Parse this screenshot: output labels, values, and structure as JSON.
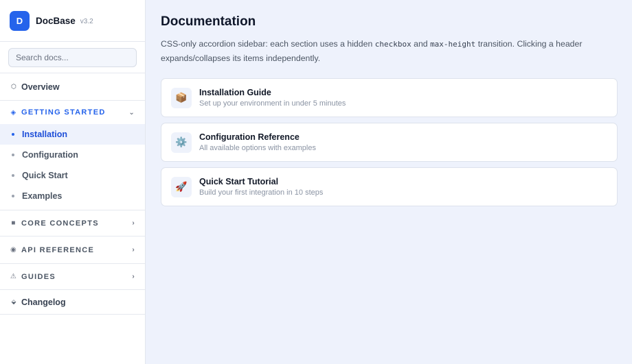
{
  "brand": {
    "logo_letter": "D",
    "name": "DocBase",
    "version": "v3.2"
  },
  "search": {
    "placeholder": "Search docs..."
  },
  "sidebar": {
    "overview": {
      "icon": "hexagon-outline-icon",
      "glyph": "⬡",
      "label": "Overview"
    },
    "sections": [
      {
        "icon": "diamond-icon",
        "glyph": "◈",
        "label": "GETTING STARTED",
        "open": true,
        "chevron": "⌄",
        "items": [
          {
            "label": "Installation",
            "active": true
          },
          {
            "label": "Configuration",
            "active": false
          },
          {
            "label": "Quick Start",
            "active": false
          },
          {
            "label": "Examples",
            "active": false
          }
        ]
      },
      {
        "icon": "square-icon",
        "glyph": "■",
        "label": "CORE CONCEPTS",
        "open": false,
        "chevron": "›"
      },
      {
        "icon": "circle-dot-icon",
        "glyph": "◉",
        "label": "API REFERENCE",
        "open": false,
        "chevron": "›"
      },
      {
        "icon": "warning-triangle-icon",
        "glyph": "⚠",
        "label": "GUIDES",
        "open": false,
        "chevron": "›"
      }
    ],
    "changelog": {
      "icon": "small-diamond-icon",
      "glyph": "⬙",
      "label": "Changelog"
    }
  },
  "main": {
    "title": "Documentation",
    "desc_1": "CSS-only accordion sidebar: each section uses a hidden ",
    "desc_code_1": "checkbox",
    "desc_2": " and ",
    "desc_code_2": "max-height",
    "desc_3": " transition. Clicking a header expands/collapses its items independently.",
    "cards": [
      {
        "icon": "package-icon",
        "glyph": "📦",
        "title": "Installation Guide",
        "subtitle": "Set up your environment in under 5 minutes"
      },
      {
        "icon": "gear-icon",
        "glyph": "⚙️",
        "title": "Configuration Reference",
        "subtitle": "All available options with examples"
      },
      {
        "icon": "rocket-icon",
        "glyph": "🚀",
        "title": "Quick Start Tutorial",
        "subtitle": "Build your first integration in 10 steps"
      }
    ]
  },
  "colors": {
    "accent": "#2563eb",
    "background": "#eef2fc",
    "sidebar": "#ffffff"
  }
}
